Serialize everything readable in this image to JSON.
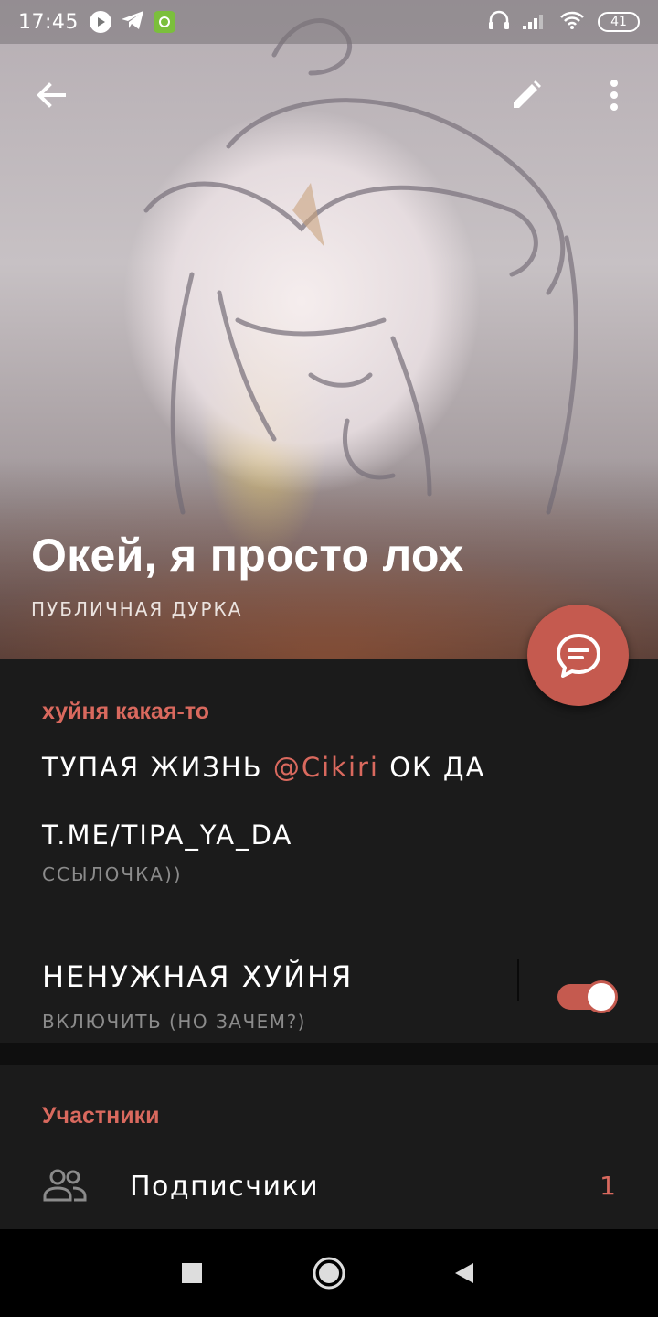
{
  "status_bar": {
    "time": "17:45",
    "battery": "41",
    "icons": [
      "youtube-icon",
      "telegram-icon",
      "app-icon",
      "headset-icon",
      "signal-icon",
      "wifi-icon",
      "battery-icon"
    ]
  },
  "header": {
    "back_icon": "arrow-left-icon",
    "edit_icon": "pencil-icon",
    "more_icon": "more-vertical-icon"
  },
  "chat": {
    "title": "Окей, я просто лох",
    "subtitle": "публичная дурка",
    "fab_icon": "chat-bubble-icon"
  },
  "info": {
    "section_title": "хуйня какая-то",
    "description_prefix": "тупая жизнь ",
    "description_mention": "@Cikiri",
    "description_suffix": " ок да",
    "link": "t.me/tipa_ya_da",
    "link_caption": "ссылочка))",
    "toggle_title": "ненужная хуйня",
    "toggle_caption": "включить (но зачем?)",
    "toggle_on": true
  },
  "members": {
    "section_title": "Участники",
    "row_label": "Подписчики",
    "row_count": "1",
    "row_icon": "people-icon"
  },
  "nav": {
    "recents_icon": "square-icon",
    "home_icon": "circle-icon",
    "back_icon": "triangle-back-icon"
  },
  "colors": {
    "accent": "#d9695e",
    "fab": "#c55a4f",
    "background": "#1b1b1b"
  }
}
